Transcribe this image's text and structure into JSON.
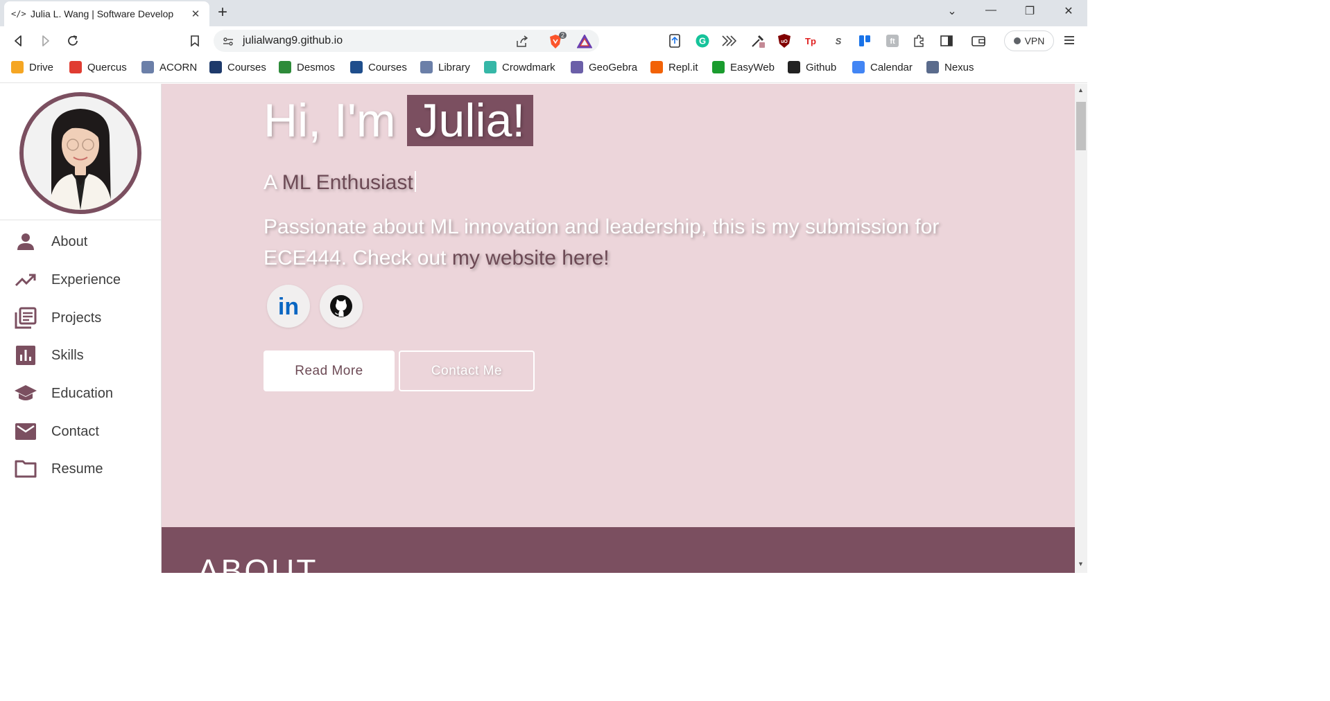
{
  "browser": {
    "tab_code": "</>",
    "tab_title": "Julia L. Wang | Software Develop",
    "tab_close": "✕",
    "new_tab": "+",
    "url": "julialwang9.github.io",
    "brave_count": "2",
    "vpn_label": "VPN",
    "window_controls": [
      "⌄",
      "—",
      "❐",
      "✕"
    ]
  },
  "bookmarks": [
    {
      "label": "Drive",
      "icon": "drive-icon",
      "color": "#f5a623"
    },
    {
      "label": "Quercus",
      "icon": "quercus-icon",
      "color": "#e03c31"
    },
    {
      "label": "ACORN",
      "icon": "acorn-icon",
      "color": "#6b7fa8"
    },
    {
      "label": "Courses",
      "icon": "courses-icon",
      "color": "#1e3a6b"
    },
    {
      "label": "Desmos",
      "icon": "desmos-icon",
      "color": "#2e8b3a"
    },
    {
      "label": "Courses",
      "icon": "courses-crest-icon",
      "color": "#1f4e8c"
    },
    {
      "label": "Library",
      "icon": "library-icon",
      "color": "#6b7fa8"
    },
    {
      "label": "Crowdmark",
      "icon": "crowdmark-icon",
      "color": "#36b7a7"
    },
    {
      "label": "GeoGebra",
      "icon": "geogebra-icon",
      "color": "#6b5fa8"
    },
    {
      "label": "Repl.it",
      "icon": "replit-icon",
      "color": "#f26207"
    },
    {
      "label": "EasyWeb",
      "icon": "easyweb-icon",
      "color": "#1a9c2e"
    },
    {
      "label": "Github",
      "icon": "github-icon",
      "color": "#222222"
    },
    {
      "label": "Calendar",
      "icon": "calendar-icon",
      "color": "#4285f4"
    },
    {
      "label": "Nexus",
      "icon": "nexus-icon",
      "color": "#5a6b8c"
    }
  ],
  "sidebar": {
    "items": [
      {
        "label": "About",
        "icon": "person-icon"
      },
      {
        "label": "Experience",
        "icon": "trending-up-icon"
      },
      {
        "label": "Projects",
        "icon": "library-books-icon"
      },
      {
        "label": "Skills",
        "icon": "bar-chart-icon"
      },
      {
        "label": "Education",
        "icon": "graduation-cap-icon"
      },
      {
        "label": "Contact",
        "icon": "mail-icon"
      },
      {
        "label": "Resume",
        "icon": "folder-icon"
      }
    ]
  },
  "hero": {
    "greeting": "Hi, I'm",
    "name": "Julia!",
    "tagline_prefix": "A",
    "tagline_typed": "ML Enthusiast",
    "description_text": "Passionate about ML innovation and leadership, this is my submission for ECE444. Check out",
    "description_link": "my website here!",
    "read_more": "Read More",
    "contact_me": "Contact Me"
  },
  "about": {
    "title": "ABOUT"
  },
  "colors": {
    "accent": "#7b4f60",
    "hero_bg": "#ecd5da",
    "link": "#6d4a55"
  }
}
